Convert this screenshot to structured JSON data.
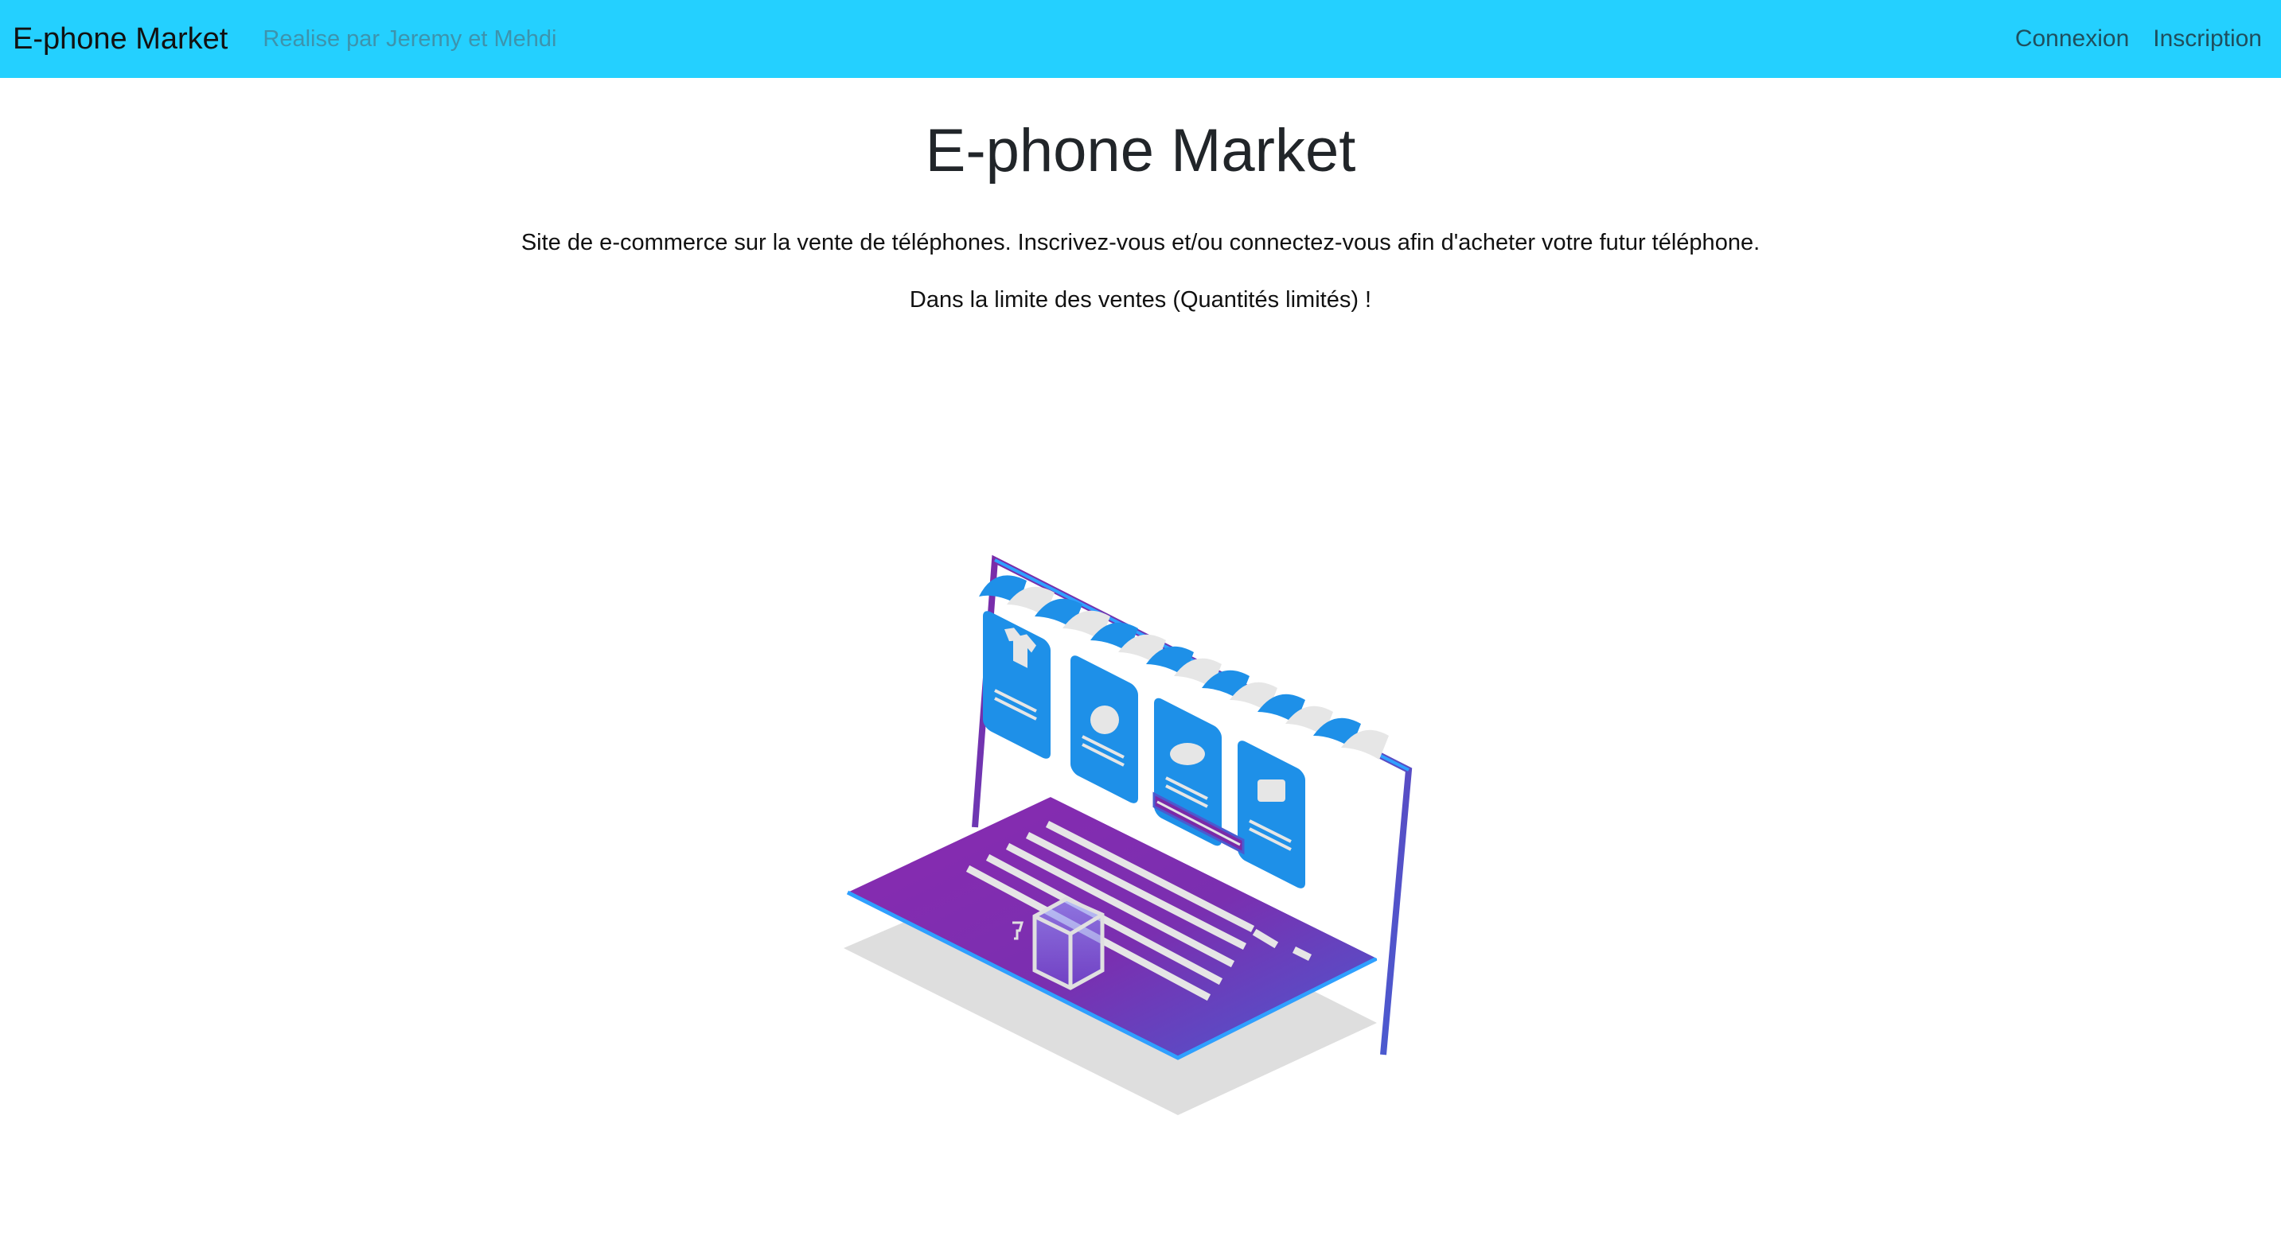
{
  "navbar": {
    "brand": "E-phone Market",
    "subtitle": "Realise par Jeremy et Mehdi",
    "links": [
      {
        "label": "Connexion"
      },
      {
        "label": "Inscription"
      }
    ],
    "background_color": "#24d0ff"
  },
  "main": {
    "title": "E-phone Market",
    "intro": "Site de e-commerce sur la vente de téléphones. Inscrivez-vous et/ou connectez-vous afin d'acheter votre futur téléphone.",
    "note": "Dans la limite des ventes (Quantités limités) !"
  },
  "illustration": {
    "name": "isometric-laptop-online-store",
    "accent_colors": {
      "purple": "#7b2aa8",
      "blue": "#1e90e8",
      "indigo": "#5a4cc8"
    },
    "product_icons": [
      "tshirt-icon",
      "apple-icon",
      "cooking-pot-icon",
      "telephone-icon"
    ]
  }
}
